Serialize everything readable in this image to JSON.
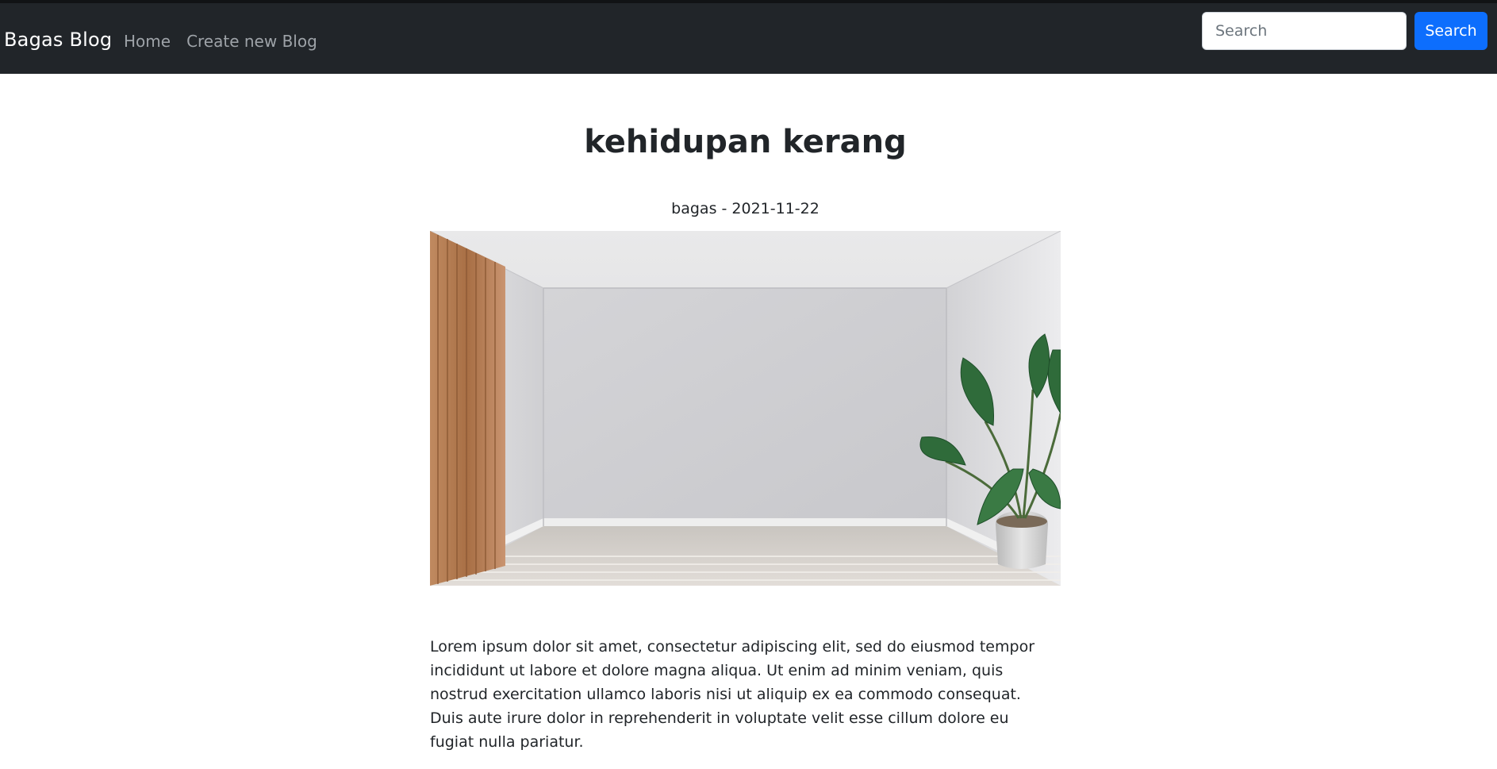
{
  "navbar": {
    "brand": "Bagas Blog",
    "links": [
      {
        "label": "Home"
      },
      {
        "label": "Create new Blog"
      }
    ],
    "search": {
      "placeholder": "Search",
      "value": "",
      "button_label": "Search"
    }
  },
  "post": {
    "title": "kehidupan kerang",
    "meta": "bagas - 2021-11-22",
    "body": "Lorem ipsum dolor sit amet, consectetur adipiscing elit, sed do eiusmod tempor incididunt ut labore et dolore magna aliqua. Ut enim ad minim veniam, quis nostrud exercitation ullamco laboris nisi ut aliquip ex ea commodo consequat. Duis aute irure dolor in reprehenderit in voluptate velit esse cillum dolore eu fugiat nulla pariatur."
  },
  "colors": {
    "navbar_bg": "#212529",
    "accent": "#0d6efd",
    "nav_link": "#9ea3a8",
    "text": "#212529"
  }
}
